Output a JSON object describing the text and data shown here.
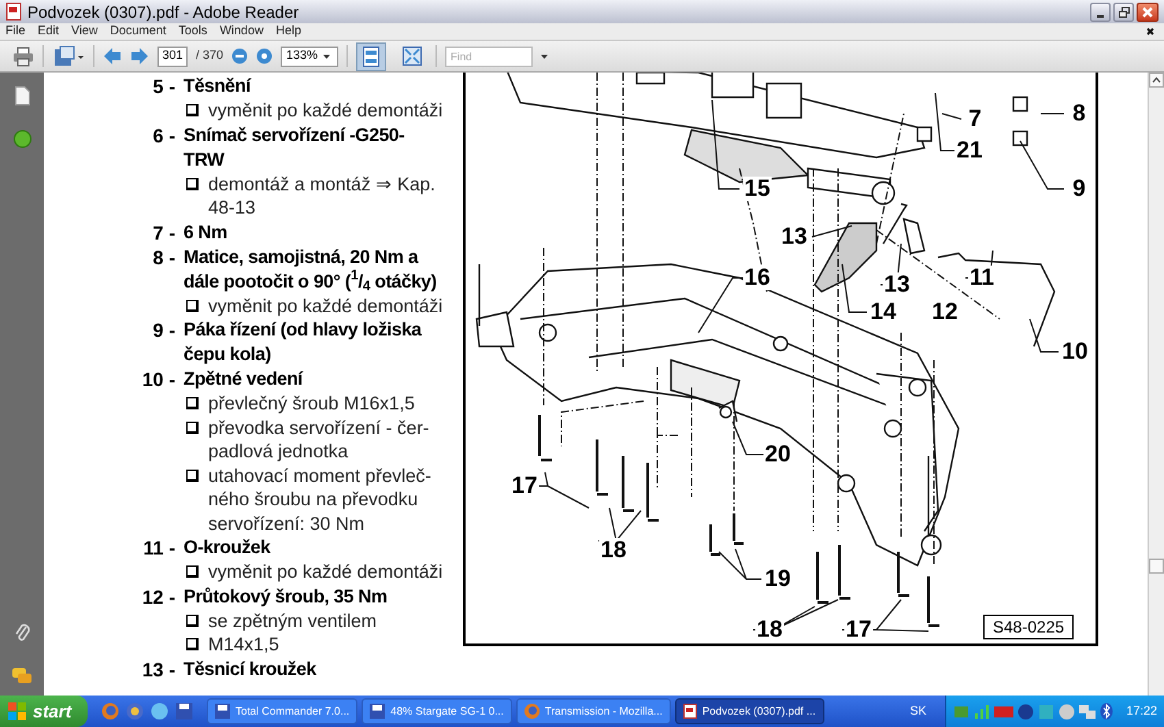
{
  "window": {
    "title": "Podvozek (0307).pdf - Adobe Reader"
  },
  "menu": [
    "File",
    "Edit",
    "View",
    "Document",
    "Tools",
    "Window",
    "Help"
  ],
  "toolbar": {
    "page_number": "301",
    "page_total": "/ 370",
    "zoom": "133%",
    "find": {
      "placeholder": "Find"
    },
    "view_buttons": [
      {
        "kind": "fit-page",
        "selected": true
      },
      {
        "kind": "full-screen",
        "selected": false
      }
    ]
  },
  "document": {
    "items": [
      {
        "number": "5 -",
        "title": "Těsnění",
        "notes": [
          "vyměnit po každé demontáži"
        ]
      },
      {
        "number": "6 -",
        "title": "Snímač servořízení -G250-\nTRW",
        "notes": [
          "demontáž a montáž ⇒ Kap.\n48-13"
        ]
      },
      {
        "number": "7 -",
        "title": "6 Nm"
      },
      {
        "number": "8 -",
        "title": "Matice, samojistná, 20 Nm a\ndále pootočit o 90° ($^{1}$/$_{4}$ otáčky)",
        "notes": [
          "vyměnit po každé demontáži"
        ]
      },
      {
        "number": "9 -",
        "title": "Páka řízení (od hlavy ložiska\nčepu kola)"
      },
      {
        "number": "10 -",
        "title": "Zpětné vedení",
        "notes": [
          "převlečný šroub M16x1,5",
          "převodka servořízení - čer-\npadlová jednotka",
          "utahovací moment převleč-\nného šroubu na převodku\nservořízení: 30 Nm"
        ]
      },
      {
        "number": "11 -",
        "title": "O-kroužek",
        "notes": [
          "vyměnit po každé demontáži"
        ]
      },
      {
        "number": "12 -",
        "title": "Průtokový šroub, 35 Nm",
        "notes": [
          "se zpětným ventilem",
          "M14x1,5"
        ]
      },
      {
        "number": "13 -",
        "title": "Těsnicí kroužek"
      }
    ],
    "figure": {
      "callouts": [
        "7",
        "8",
        "21",
        "9",
        "15",
        "13",
        "16",
        "11",
        "13",
        "14",
        "12",
        "10",
        "20",
        "17",
        "18",
        "19",
        "18",
        "17"
      ],
      "figure_id": "S48-0225"
    }
  },
  "taskbar": {
    "start": "start",
    "tasks": [
      {
        "kind": "disk",
        "label": "Total Commander 7.0...",
        "selected": false
      },
      {
        "kind": "disk",
        "label": "48% Stargate SG-1 0...",
        "selected": false
      },
      {
        "kind": "browser",
        "label": "Transmission - Mozilla...",
        "selected": false
      },
      {
        "kind": "pdf",
        "label": "Podvozek (0307).pdf ...",
        "selected": true
      }
    ],
    "language": "SK",
    "clock": "17:22"
  }
}
